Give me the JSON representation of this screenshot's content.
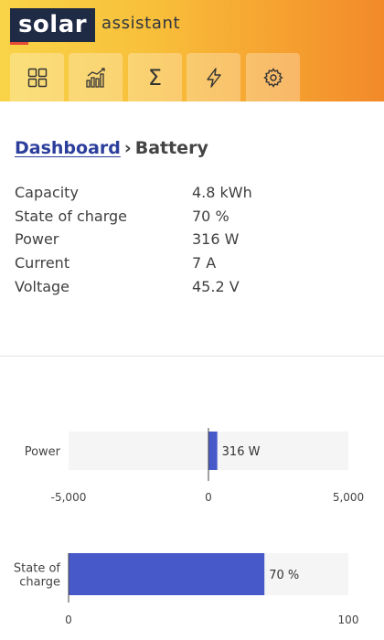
{
  "header": {
    "logo": {
      "main": "solar",
      "suffix": "assistant"
    },
    "nav": [
      {
        "icon": "dashboard-grid-icon"
      },
      {
        "icon": "charts-icon"
      },
      {
        "icon": "totals-sigma-icon",
        "glyph": "Σ"
      },
      {
        "icon": "power-bolt-icon"
      },
      {
        "icon": "settings-gear-icon"
      }
    ]
  },
  "breadcrumb": {
    "link": "Dashboard",
    "separator": "›",
    "current": "Battery"
  },
  "stats": [
    {
      "label": "Capacity",
      "value": "4.8 kWh"
    },
    {
      "label": "State of charge",
      "value": "70 %"
    },
    {
      "label": "Power",
      "value": "316 W"
    },
    {
      "label": "Current",
      "value": "7 A"
    },
    {
      "label": "Voltage",
      "value": "45.2 V"
    }
  ],
  "chart_data": [
    {
      "type": "bar",
      "orientation": "horizontal",
      "categories": [
        "Power"
      ],
      "values": [
        316
      ],
      "data_labels": [
        "316 W"
      ],
      "xlim": [
        -5000,
        5000
      ],
      "ticks": [
        "-5,000",
        "0",
        "5,000"
      ],
      "bar_color": "#4759c9"
    },
    {
      "type": "bar",
      "orientation": "horizontal",
      "categories": [
        "State of charge"
      ],
      "category_lines": [
        "State of",
        "charge"
      ],
      "values": [
        70
      ],
      "data_labels": [
        "70 %"
      ],
      "xlim": [
        0,
        100
      ],
      "ticks": [
        "0",
        "100"
      ],
      "bar_color": "#4759c9"
    }
  ]
}
